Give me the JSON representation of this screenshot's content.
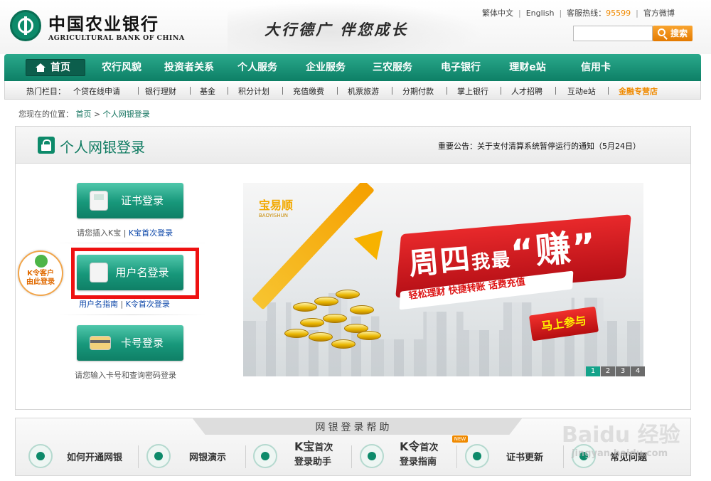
{
  "header": {
    "bank_name_cn": "中国农业银行",
    "bank_name_en": "AGRICULTURAL BANK OF CHINA",
    "slogan": "大行德广  伴您成长",
    "links": [
      "繁体中文",
      "English"
    ],
    "hotline_label": "客服热线：",
    "hotline_number": "95599",
    "weibo": "官方微博",
    "search_placeholder": "",
    "search_button": "搜索"
  },
  "nav": {
    "home": "首页",
    "items": [
      "农行风貌",
      "投资者关系",
      "个人服务",
      "企业服务",
      "三农服务",
      "电子银行",
      "理财e站",
      "信用卡"
    ]
  },
  "hotbar": {
    "label": "热门栏目：",
    "items": [
      "个贷在线申请",
      "银行理财",
      "基金",
      "积分计划",
      "充值缴费",
      "机票旅游",
      "分期付款",
      "掌上银行",
      "人才招聘",
      "互动e站",
      "金融专营店"
    ]
  },
  "breadcrumb": {
    "prefix": "您现在的位置：",
    "home": "首页",
    "sep": ">",
    "current": "个人网银登录"
  },
  "panel": {
    "title": "个人网银登录",
    "notice": "重要公告：关于支付清算系统暂停运行的通知（5月24日）"
  },
  "login": {
    "cert_button": "证书登录",
    "cert_hint": "请您插入K宝",
    "cert_link": "K宝首次登录",
    "username_button": "用户名登录",
    "username_link1": "用户名指南",
    "username_link2": "K令首次登录",
    "card_button": "卡号登录",
    "card_hint": "请您输入卡号和查询密码登录",
    "ktag_line1": "K令客户",
    "ktag_line2": "由此登录"
  },
  "banner": {
    "brand": "宝易顺",
    "brand_sub": "BAOYISHUN",
    "headline_a": "周四",
    "headline_b": "我最",
    "headline_c": "“赚”",
    "strip": "轻松理财 快捷转账 话费充值",
    "cta": "马上参与",
    "pages": [
      "1",
      "2",
      "3",
      "4"
    ],
    "active_page": 0
  },
  "help": {
    "title": "网银登录帮助",
    "items": [
      {
        "label": "如何开通网银"
      },
      {
        "label": "网银演示"
      },
      {
        "label_big": "K宝",
        "label_small": "首次",
        "label2": "登录助手"
      },
      {
        "label_big": "K令",
        "label_small": "首次",
        "label2": "登录指南",
        "badge": "NEW"
      },
      {
        "label": "证书更新"
      },
      {
        "label": "常见问题"
      }
    ]
  },
  "watermark": {
    "text": "Baidu 经验",
    "url": "jingyan.baidu.com"
  },
  "colors": {
    "brand_green": "#0d8a6a",
    "accent_orange": "#f08a00",
    "highlight_red": "#ee1111",
    "link_blue": "#0a45a8"
  }
}
